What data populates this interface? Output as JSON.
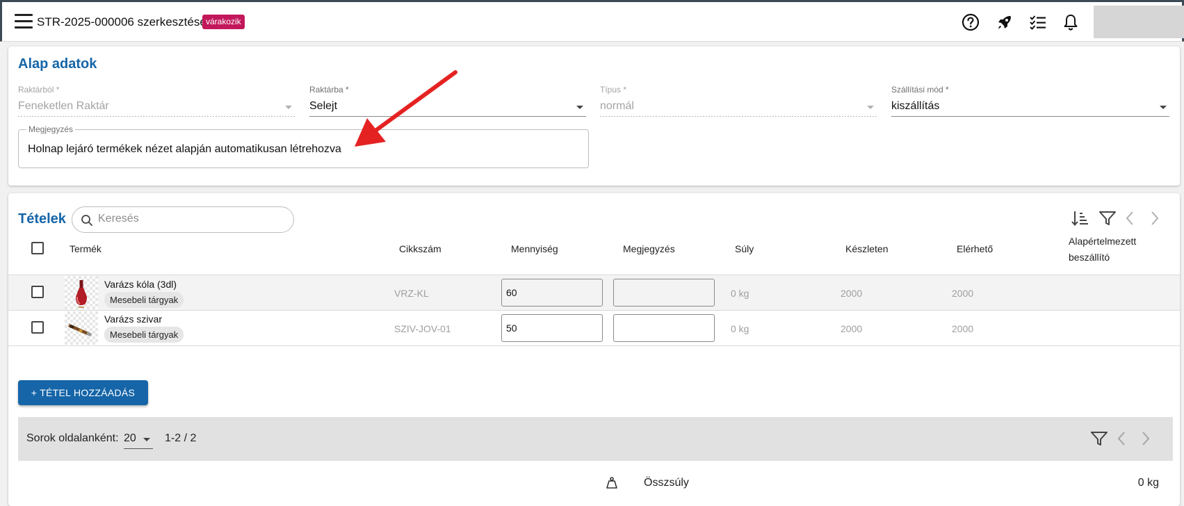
{
  "header": {
    "title": "STR-2025-000006 szerkesztése",
    "status": "várakozik",
    "icons": [
      "menu-icon",
      "help-icon",
      "rocket-icon",
      "tasklist-icon",
      "bell-icon"
    ]
  },
  "basic": {
    "title": "Alap adatok",
    "fields": {
      "from_label": "Raktárból *",
      "from_value": "Feneketlen Raktár",
      "to_label": "Raktárba *",
      "to_value": "Selejt",
      "type_label": "Típus *",
      "type_value": "normál",
      "shipping_label": "Szállítási mód *",
      "shipping_value": "kiszállítás"
    },
    "note_label": "Megjegyzés",
    "note_value": "Holnap lejáró termékek nézet alapján automatikusan létrehozva"
  },
  "items": {
    "title": "Tételek",
    "search_placeholder": "Keresés",
    "columns": {
      "product": "Termék",
      "sku": "Cikkszám",
      "quantity": "Mennyiség",
      "note": "Megjegyzés",
      "weight": "Súly",
      "stock": "Készleten",
      "available": "Elérhető",
      "supplier_line1": "Alapértelmezett",
      "supplier_line2": "beszállító"
    },
    "rows": [
      {
        "name": "Varázs kóla (3dl)",
        "category": "Mesebeli tárgyak",
        "sku": "VRZ-KL",
        "quantity": "60",
        "note": "",
        "weight": "0 kg",
        "stock": "2000",
        "available": "2000",
        "supplier": ""
      },
      {
        "name": "Varázs szivar",
        "category": "Mesebeli tárgyak",
        "sku": "SZIV-JOV-01",
        "quantity": "50",
        "note": "",
        "weight": "0 kg",
        "stock": "2000",
        "available": "2000",
        "supplier": ""
      }
    ],
    "add_button": "+ TÉTEL HOZZÁADÁS",
    "pagination": {
      "rows_per_page_label": "Sorok oldalanként:",
      "rows_per_page": "20",
      "range": "1-2 / 2"
    },
    "total_weight_label": "Összsúly",
    "total_weight_value": "0 kg"
  },
  "colors": {
    "accent": "#1565a8",
    "status_badge": "#c2185b",
    "annotation_arrow": "#e52222"
  }
}
